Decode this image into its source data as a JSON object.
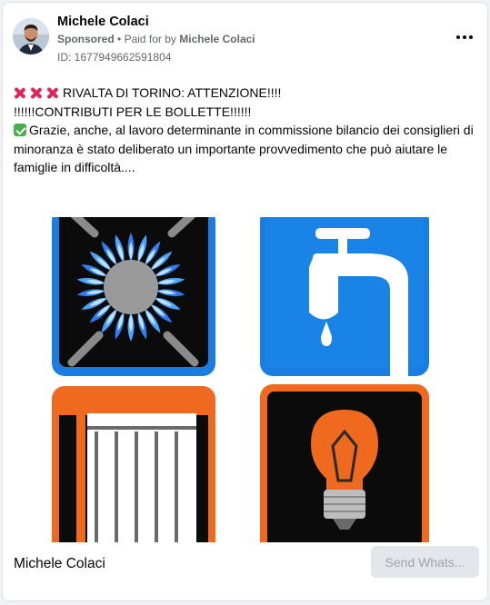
{
  "post": {
    "author": "Michele Colaci",
    "sponsored_label": "Sponsored",
    "separator": "•",
    "paid_for_prefix": "Paid for by",
    "paid_for_name": "Michele Colaci",
    "ad_id": "ID: 1677949662591804"
  },
  "body": {
    "line1": "RIVALTA DI TORINO: ATTENZIONE!!!!",
    "line2": "!!!!!!CONTRIBUTI PER LE BOLLETTE!!!!!!",
    "line3": "Grazie, anche, al lavoro determinante in commissione bilancio dei consiglieri di minoranza è stato deliberato un importante provvedimento che può aiutare le famiglie in difficoltà...."
  },
  "icons": {
    "avatar": "avatar-photo",
    "more": "more-horizontal-icon",
    "red_x": "red-x-icon",
    "check": "green-check-icon",
    "tiles": [
      "gas-burner-icon",
      "water-tap-icon",
      "radiator-icon",
      "light-bulb-icon"
    ]
  },
  "colors": {
    "blue_tile": "#1a7de0",
    "orange_tile": "#ef6a1e",
    "red_x": "#e0245e",
    "check": "#47b04b"
  },
  "footer": {
    "page_name": "Michele Colaci",
    "cta_label": "Send Whats..."
  }
}
